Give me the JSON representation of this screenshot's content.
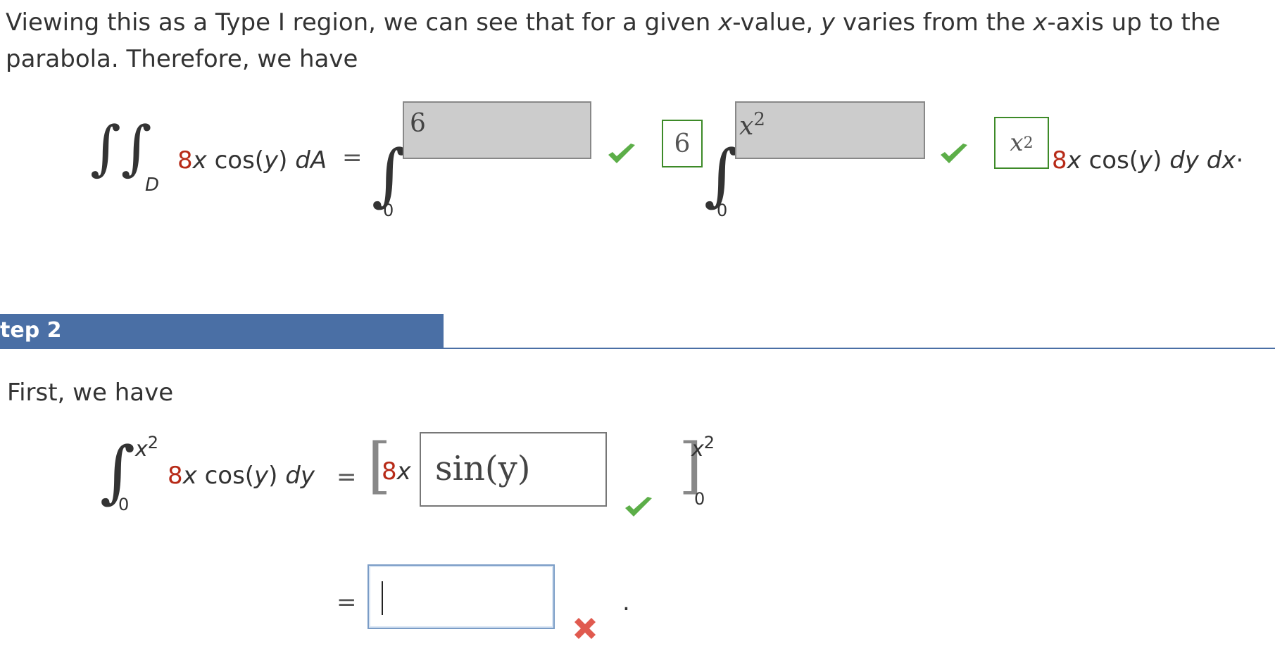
{
  "intro": {
    "line1_a": "Viewing this as a Type I region, we can see that for a given ",
    "line1_x": "x",
    "line1_b": "-value, ",
    "line1_y": "y",
    "line1_c": " varies from the ",
    "line1_x2": "x",
    "line1_d": "-axis up to the",
    "line2": "parabola. Therefore, we have"
  },
  "eq1": {
    "lhs_coef": "8",
    "lhs_var": "x",
    "lhs_rest": " cos(",
    "lhs_y": "y",
    "lhs_close": ") ",
    "lhs_dA": "dA",
    "lhs_equals": "=",
    "region": "D",
    "outer_lower": "0",
    "outer_upper_input": "6",
    "outer_upper_answer": "6",
    "inner_lower": "0",
    "inner_upper_input": "x2",
    "inner_upper_answer": "x2",
    "rhs_coef": "8",
    "rhs_var": "x",
    "rhs_rest": " cos(",
    "rhs_y": "y",
    "rhs_close": ") ",
    "rhs_dy": "dy",
    "rhs_dx": "dx",
    "rhs_dot": "·"
  },
  "step2": {
    "title": "tep 2",
    "intro": "First, we have",
    "int_upper_base": "x",
    "int_upper_exp": "2",
    "int_lower": "0",
    "int_coef": "8",
    "int_var": "x",
    "int_rest": " cos(",
    "int_y": "y",
    "int_close": ") ",
    "int_dy": "dy",
    "equals": "=",
    "bracket_coef": "8",
    "bracket_var": "x",
    "antiderivative": "sin(y)",
    "eval_upper_base": "x",
    "eval_upper_exp": "2",
    "eval_lower": "0",
    "equals2": "=",
    "answer_value": "",
    "period": "."
  },
  "colors": {
    "accent": "#4a6fa5",
    "correct": "#5cae48",
    "incorrect": "#e05a4f",
    "coefficient": "#b72a17"
  }
}
